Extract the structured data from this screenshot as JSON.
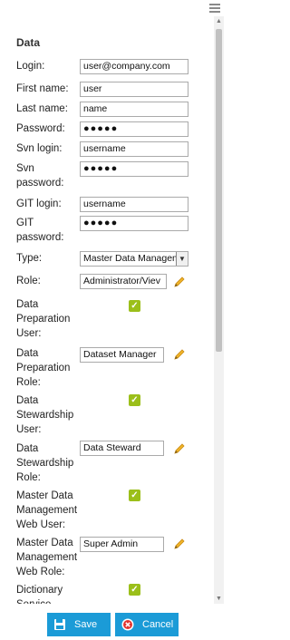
{
  "section": {
    "title": "Data"
  },
  "fields": {
    "login": {
      "label": "Login:",
      "value": "user@company.com"
    },
    "first_name": {
      "label": "First name:",
      "value": "user"
    },
    "last_name": {
      "label": "Last name:",
      "value": "name"
    },
    "password": {
      "label": "Password:",
      "value": "●●●●●"
    },
    "svn_login": {
      "label": "Svn login:",
      "value": "username"
    },
    "svn_password": {
      "label": "Svn password:",
      "value": "●●●●●"
    },
    "git_login": {
      "label": "GIT login:",
      "value": "username"
    },
    "git_password": {
      "label": "GIT password:",
      "value": "●●●●●"
    },
    "type": {
      "label": "Type:",
      "value": "Master Data Managem"
    },
    "role": {
      "label": "Role:",
      "value": "Administrator/Viev"
    },
    "dp_user": {
      "label": "Data Preparation User:",
      "checked": true
    },
    "dp_role": {
      "label": "Data Preparation Role:",
      "value": "Dataset Manager"
    },
    "ds_user": {
      "label": "Data Stewardship User:",
      "checked": true
    },
    "ds_role": {
      "label": "Data Stewardship Role:",
      "value": "Data Steward"
    },
    "mdm_user": {
      "label": "Master Data Management Web User:",
      "checked": true
    },
    "mdm_role": {
      "label": "Master Data Management Web Role:",
      "value": "Super Admin"
    },
    "dict_user": {
      "label": "Dictionary Service User:",
      "checked": true
    }
  },
  "footer": {
    "save_label": "Save",
    "cancel_label": "Cancel"
  },
  "icons": {
    "menu": "hamburger-menu-icon",
    "edit": "pencil-icon",
    "check": "checkmark-icon",
    "save": "floppy-disk-icon",
    "cancel": "cancel-circle-icon"
  },
  "colors": {
    "button": "#1b9bd7",
    "checkbox": "#9bbf1a",
    "pencil": "#e8a21a",
    "cancel_icon": "#e2322d"
  }
}
